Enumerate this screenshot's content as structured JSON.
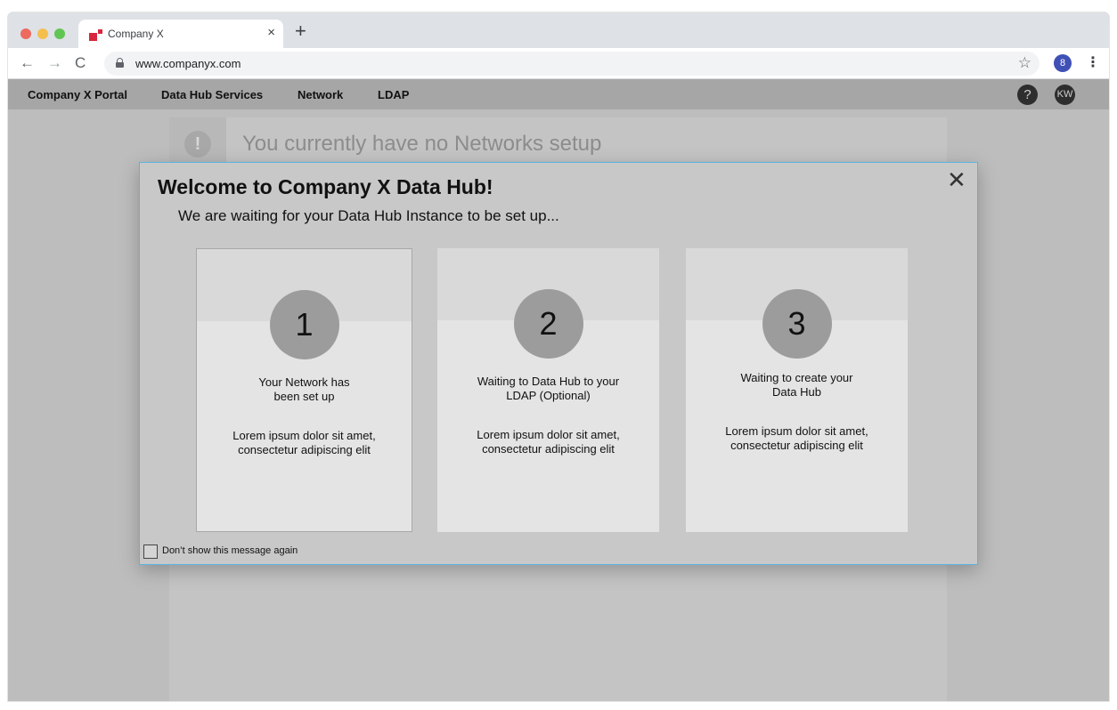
{
  "browser": {
    "tab_title": "Company X",
    "tab_close": "×",
    "new_tab": "+",
    "url": "www.companyx.com",
    "back": "←",
    "forward": "→",
    "reload": "C",
    "bookmark": "☆",
    "menu": "⋮",
    "profile_glyph": "8"
  },
  "nav": {
    "items": [
      {
        "label": "Company X Portal"
      },
      {
        "label": "Data Hub Services"
      },
      {
        "label": "Network"
      },
      {
        "label": "LDAP"
      }
    ],
    "help": "?",
    "avatar": "KW"
  },
  "content": {
    "notice_glyph": "!",
    "notice": "You currently have no Networks setup"
  },
  "modal": {
    "title": "Welcome to Company X Data Hub!",
    "subtitle": "We are waiting for your Data Hub Instance to be set up...",
    "close": "✕",
    "steps": [
      {
        "number": "1",
        "title": "Your Network has\nbeen set up",
        "description": "Lorem ipsum dolor sit amet,\nconsectetur adipiscing elit"
      },
      {
        "number": "2",
        "title": "Waiting to Data Hub to your\nLDAP (Optional)",
        "description": "Lorem ipsum dolor sit amet,\nconsectetur adipiscing elit"
      },
      {
        "number": "3",
        "title": "Waiting to create your\nData Hub",
        "description": "Lorem ipsum dolor sit amet,\nconsectetur adipiscing elit"
      }
    ],
    "dont_show_label": "Don’t show this message again",
    "dont_show_checked": false
  },
  "colors": {
    "accent_border": "#5ab3e0",
    "favicon": "#d7263d",
    "profile": "#3f51b5"
  }
}
